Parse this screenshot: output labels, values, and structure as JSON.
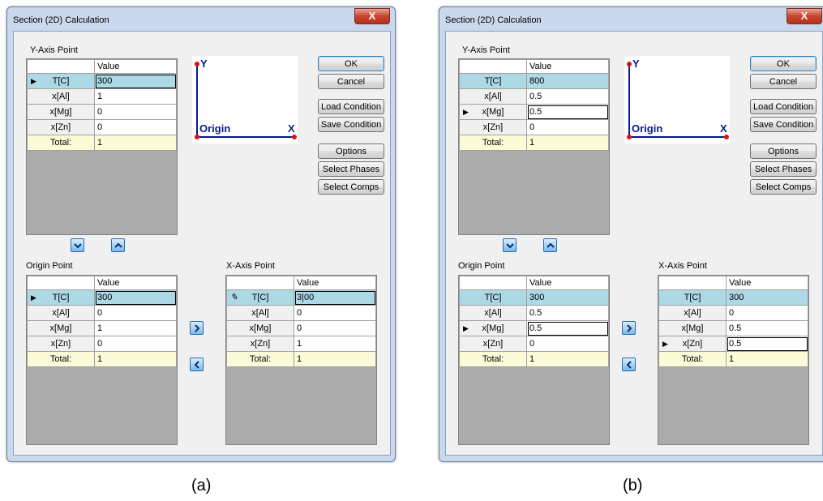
{
  "captions": {
    "a": "(a)",
    "b": "(b)"
  },
  "dialog": {
    "title": "Section (2D) Calculation",
    "close_glyph": "X",
    "y_axis_label": "Y-Axis Point",
    "origin_label": "Origin Point",
    "x_axis_label": "X-Axis Point",
    "value_header": "Value",
    "diagram": {
      "y": "Y",
      "x": "X",
      "origin": "Origin"
    },
    "buttons": {
      "ok": "OK",
      "cancel": "Cancel",
      "load": "Load Condition",
      "save": "Save Condition",
      "options": "Options",
      "phases": "Select Phases",
      "comps": "Select Comps"
    },
    "row_labels": [
      "T[C]",
      "x[Al]",
      "x[Mg]",
      "x[Zn]",
      "Total:"
    ]
  },
  "panel_a": {
    "y_axis": [
      "300",
      "1",
      "0",
      "0",
      "1"
    ],
    "origin": [
      "300",
      "0",
      "1",
      "0",
      "1"
    ],
    "x_axis": [
      "3|00",
      "0",
      "0",
      "1",
      "1"
    ]
  },
  "panel_b": {
    "y_axis": [
      "800",
      "0.5",
      "0.5",
      "0",
      "1"
    ],
    "origin": [
      "300",
      "0.5",
      "0.5",
      "0",
      "1"
    ],
    "x_axis": [
      "300",
      "0",
      "0.5",
      "0.5",
      "1"
    ]
  },
  "icons": {
    "down": "chevron-down-icon",
    "up": "chevron-up-icon",
    "right": "chevron-right-icon",
    "left": "chevron-left-icon"
  }
}
